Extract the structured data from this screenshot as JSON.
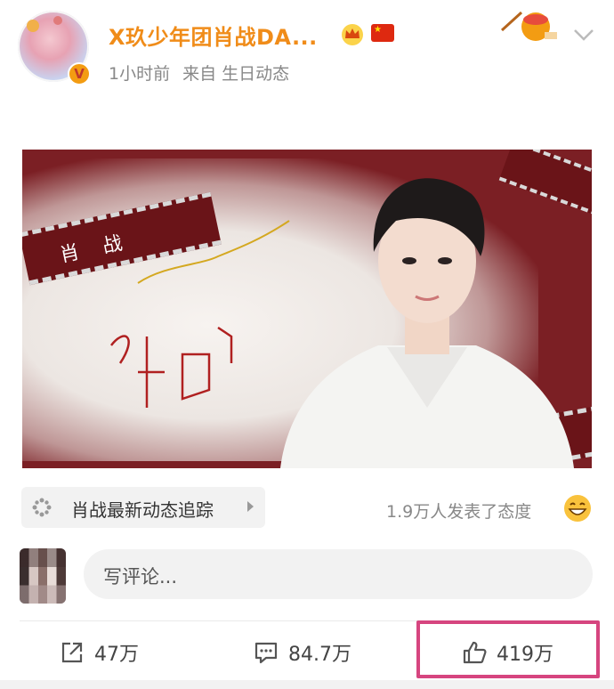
{
  "post": {
    "username": "X玖少年团肖战DA...",
    "time": "1小时前",
    "source": "来自 生日动态"
  },
  "topic": {
    "label": "肖战最新动态追踪"
  },
  "reactions": {
    "text": "1.9万人发表了态度"
  },
  "comment": {
    "placeholder": "写评论..."
  },
  "actions": {
    "share_count": "47万",
    "comment_count": "84.7万",
    "like_count": "419万"
  },
  "photo": {
    "film_text": "肖 战"
  },
  "colors": {
    "username": "#f08c19",
    "highlight": "#d6457f"
  }
}
